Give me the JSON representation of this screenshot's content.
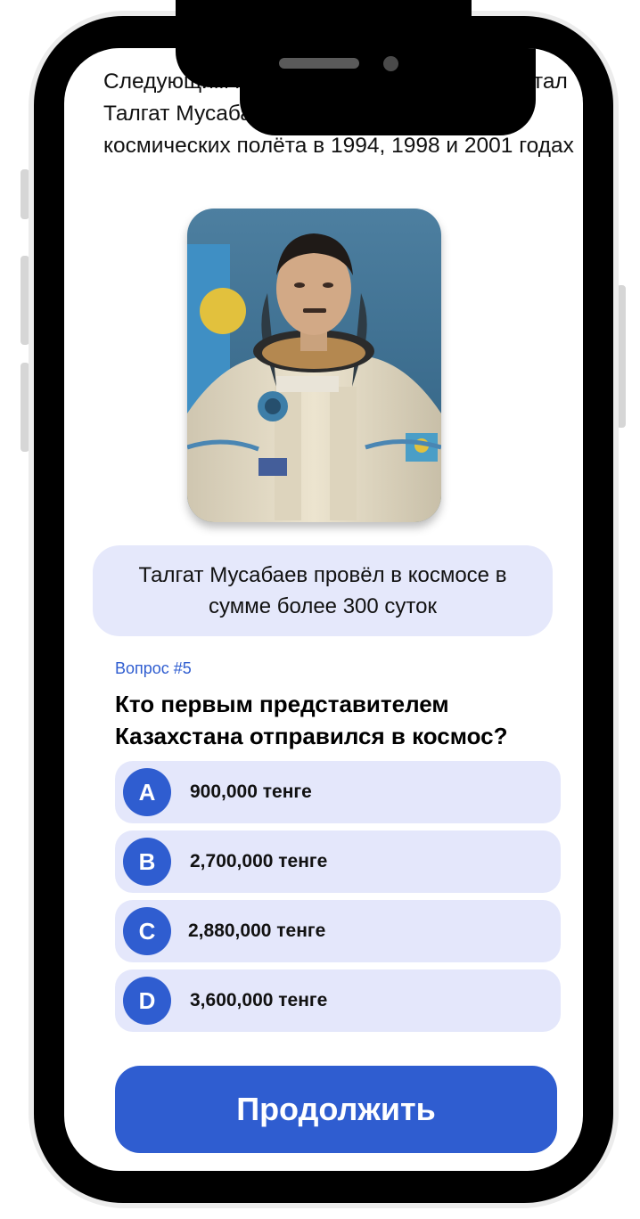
{
  "intro_text": "Следующим космонавтом из Казахстана стал Талгат Мусабаев, который совершил три космических полёта в 1994, 1998 и 2001 годах",
  "fact_text": "Талгат Мусабаев провёл в космосе в сумме более 300 суток",
  "question": {
    "number_label": "Вопрос #5",
    "text": "Кто первым представителем Казахстана отправился в космос?"
  },
  "options": [
    {
      "letter": "A",
      "text": "900,000 тенге"
    },
    {
      "letter": "B",
      "text": "2,700,000 тенге"
    },
    {
      "letter": "C",
      "text": "2,880,000 тенге"
    },
    {
      "letter": "D",
      "text": "3,600,000 тенге"
    }
  ],
  "continue_label": "Продолжить",
  "colors": {
    "accent": "#2f5dd0",
    "option_bg": "#e4e7fb",
    "fact_bg": "#e5e8fb"
  }
}
